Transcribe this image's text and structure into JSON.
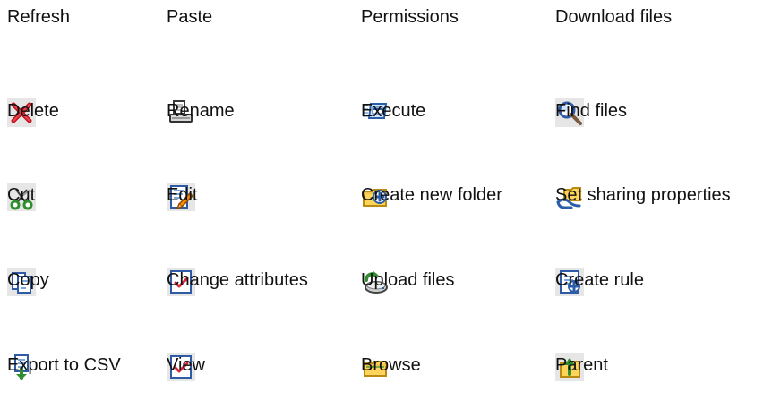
{
  "header_row": [
    "Refresh",
    "Paste",
    "Permissions",
    "Download files"
  ],
  "items": [
    {
      "label": "Delete",
      "icon": "delete-icon"
    },
    {
      "label": "Rename",
      "icon": "rename-icon"
    },
    {
      "label": "Execute",
      "icon": "execute-icon"
    },
    {
      "label": "Find files",
      "icon": "find-files-icon"
    },
    {
      "label": "Cut",
      "icon": "cut-icon"
    },
    {
      "label": "Edit",
      "icon": "edit-icon"
    },
    {
      "label": "Create new folder",
      "icon": "create-folder-icon"
    },
    {
      "label": "Set sharing properties",
      "icon": "sharing-icon"
    },
    {
      "label": "Copy",
      "icon": "copy-icon"
    },
    {
      "label": "Change attributes",
      "icon": "change-attributes-icon"
    },
    {
      "label": "Upload files",
      "icon": "upload-icon"
    },
    {
      "label": "Create rule",
      "icon": "create-rule-icon"
    },
    {
      "label": "Export to CSV",
      "icon": "export-csv-icon"
    },
    {
      "label": "View",
      "icon": "view-icon"
    },
    {
      "label": "Browse",
      "icon": "browse-icon"
    },
    {
      "label": "Parent",
      "icon": "parent-icon"
    }
  ]
}
